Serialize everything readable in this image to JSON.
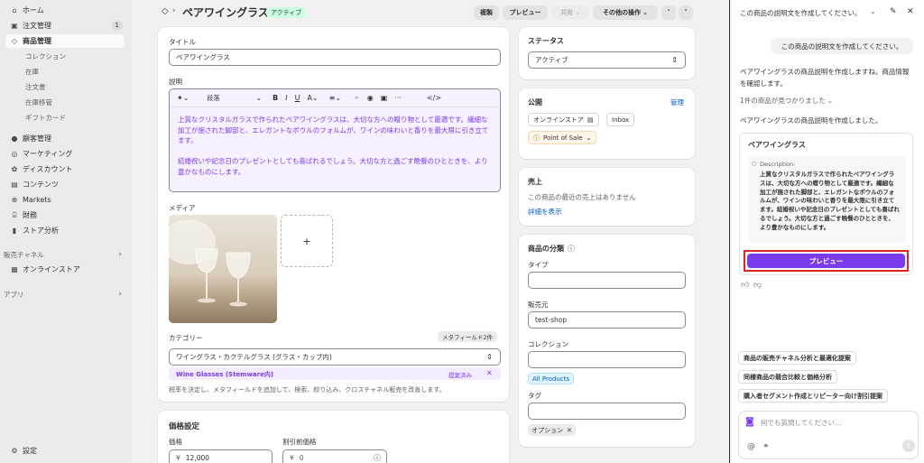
{
  "sidebar": {
    "items": [
      {
        "label": "ホーム",
        "icon": "home-icon"
      },
      {
        "label": "注文管理",
        "icon": "inbox-icon",
        "badge": "1"
      },
      {
        "label": "商品管理",
        "icon": "tag-icon"
      },
      {
        "label": "コレクション"
      },
      {
        "label": "在庫"
      },
      {
        "label": "注文書"
      },
      {
        "label": "在庫移管"
      },
      {
        "label": "ギフトカード"
      },
      {
        "label": "顧客管理",
        "icon": "person-icon"
      },
      {
        "label": "マーケティング",
        "icon": "target-icon"
      },
      {
        "label": "ディスカウント",
        "icon": "discount-icon"
      },
      {
        "label": "コンテンツ",
        "icon": "content-icon"
      },
      {
        "label": "Markets",
        "icon": "globe-icon"
      },
      {
        "label": "財務",
        "icon": "bank-icon"
      },
      {
        "label": "ストア分析",
        "icon": "chart-icon"
      }
    ],
    "sales_channels_label": "販売チャネル",
    "online_store_label": "オンラインストア",
    "apps_label": "アプリ",
    "settings_label": "設定"
  },
  "header": {
    "title": "ペアワイングラス",
    "status_badge": "アクティブ",
    "duplicate_label": "複製",
    "preview_label": "プレビュー",
    "share_label": "共有",
    "more_actions_label": "その他の操作"
  },
  "product": {
    "title_label": "タイトル",
    "title_value": "ペアワイングラス",
    "description_label": "説明",
    "paragraph_style": "段落",
    "description_p1": "上質なクリスタルガラスで作られたペアワイングラスは、大切な方への贈り物として最適です。繊細な加工が施された脚部と、エレガントなボウルのフォルムが、ワインの味わいと香りを最大限に引き立てます。",
    "description_p2": "結婚祝いや記念日のプレゼントとしても喜ばれるでしょう。大切な方と過ごす晩餐のひとときを、より豊かなものにします。",
    "media_label": "メディア",
    "add_media": "+",
    "category_label": "カテゴリー",
    "metafield_badge": "メタフィールド2件",
    "category_value": "ワイングラス・カクテルグラス (グラス・カップ内)",
    "suggestion_name": "Wine Glasses (Stemware内)",
    "suggestion_status": "提案済み",
    "category_help": "税率を決定し、メタフィールドを追加して、検索、絞り込み、クロスチャネル販売を改善します。",
    "pricing_title": "価格設定",
    "price_label": "価格",
    "price_value": "12,000",
    "compare_label": "割引前価格",
    "compare_value": "0",
    "currency": "¥"
  },
  "status": {
    "label": "ステータス",
    "value": "アクティブ"
  },
  "publishing": {
    "label": "公開",
    "manage": "管理",
    "channels": [
      "オンラインストア",
      "Inbox",
      "Point of Sale"
    ]
  },
  "sales": {
    "label": "売上",
    "text": "この商品の最近の売上はありません",
    "link": "詳細を表示"
  },
  "organization": {
    "label": "商品の分類",
    "type_label": "タイプ",
    "vendor_label": "販売元",
    "vendor_value": "test-shop",
    "collection_label": "コレクション",
    "collection_chip": "All Products",
    "tags_label": "タグ",
    "tag_chip": "オプション"
  },
  "assistant": {
    "header_title": "この商品の説明文を作成してください。",
    "user_message": "この商品の説明文を作成してください。",
    "reply1": "ペアワイングラスの商品説明を作成しますね。商品情報を確認します。",
    "found_text": "1件の商品が見つかりました",
    "reply2": "ペアワイングラスの商品説明を作成しました。",
    "card_title": "ペアワイングラス",
    "desc_label": "Description:",
    "desc_text": "上質なクリスタルガラスで作られたペアワイングラスは、大切な方への贈り物として最適です。繊細な加工が施された脚部と、エレガントなボウルのフォルムが、ワインの味わいと香りを最大限に引き立てます。結婚祝いや記念日のプレゼントとしても喜ばれるでしょう。大切な方と過ごす晩餐のひとときを、より豊かなものにします。",
    "preview_button": "プレビュー",
    "suggestions": [
      "商品の販売チャネル分析と最適化提案",
      "同様商品の競合比較と価格分析",
      "購入者セグメント作成とリピーター向け割引提案"
    ],
    "input_placeholder": "何でも質問してください..."
  },
  "colors": {
    "accent": "#7c3aed",
    "highlight": "#e02424",
    "active_badge": "#cdfee1"
  }
}
